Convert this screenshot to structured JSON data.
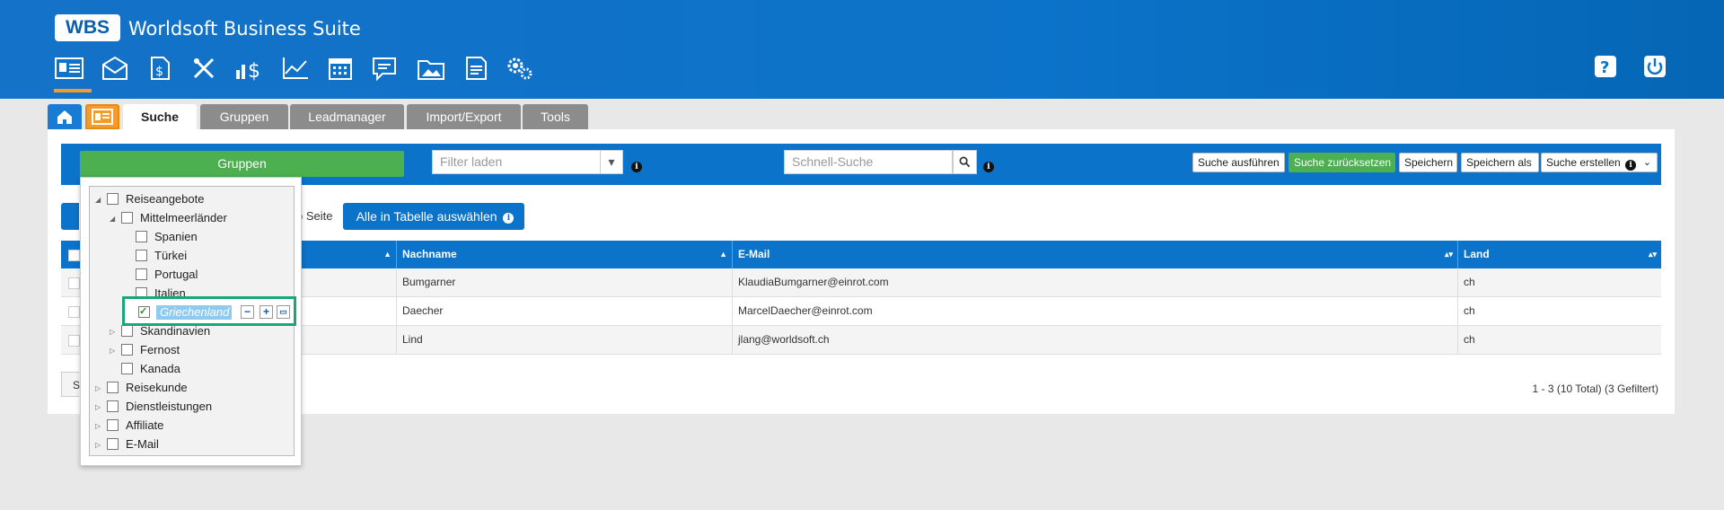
{
  "header": {
    "logo_text": "WBS",
    "app_title": "Worldsoft Business Suite",
    "module_icons": [
      "contacts-card-icon",
      "mail-icon",
      "document-dollar-icon",
      "tools-icon",
      "sales-dollar-icon",
      "chart-line-icon",
      "calendar-icon",
      "message-icon",
      "folder-images-icon",
      "newsletter-icon",
      "settings-gears-icon"
    ],
    "right_icons": [
      "help-icon",
      "power-icon"
    ]
  },
  "tabs": [
    {
      "label": "",
      "icon": "home-icon"
    },
    {
      "label": "",
      "icon": "contact-card-icon"
    },
    {
      "label": "Suche"
    },
    {
      "label": "Gruppen"
    },
    {
      "label": "Leadmanager"
    },
    {
      "label": "Import/Export"
    },
    {
      "label": "Tools"
    }
  ],
  "toolbar": {
    "groups_button": "Gruppen",
    "filter_placeholder": "Filter laden",
    "quick_search_placeholder": "Schnell-Suche",
    "buttons": [
      "Suche ausführen",
      "Suche zurücksetzen",
      "Speichern",
      "Speichern als",
      "Suche erstellen"
    ]
  },
  "actions": {
    "per_page_suffix": "o Seite",
    "select_all_button": "Alle in Tabelle auswählen"
  },
  "table": {
    "columns": [
      "Nachname",
      "E-Mail",
      "Land"
    ],
    "rows": [
      {
        "nachname": "Bumgarner",
        "email": "KlaudiaBumgarner@einrot.com",
        "land": "ch"
      },
      {
        "nachname": "Daecher",
        "email": "MarcelDaecher@einrot.com",
        "land": "ch"
      },
      {
        "nachname": "Lind",
        "email": "jlang@worldsoft.ch",
        "land": "ch"
      }
    ],
    "bottom_left_frag": "S",
    "pagination": "1 - 3 (10 Total) (3 Gefiltert)"
  },
  "tree": {
    "nodes": [
      {
        "label": "Reiseangebote",
        "level": 0,
        "expanded": true
      },
      {
        "label": "Mittelmeerländer",
        "level": 1,
        "expanded": true
      },
      {
        "label": "Spanien",
        "level": 2
      },
      {
        "label": "Türkei",
        "level": 2
      },
      {
        "label": "Portugal",
        "level": 2
      },
      {
        "label": "Italien",
        "level": 2
      },
      {
        "label": "Griechenland",
        "level": 2,
        "checked": true,
        "selected": true
      },
      {
        "label": "Skandinavien",
        "level": 1,
        "collapsed": true
      },
      {
        "label": "Fernost",
        "level": 1,
        "collapsed": true
      },
      {
        "label": "Kanada",
        "level": 1
      },
      {
        "label": "Reisekunde",
        "level": 0,
        "collapsed": true
      },
      {
        "label": "Dienstleistungen",
        "level": 0,
        "collapsed": true
      },
      {
        "label": "Affiliate",
        "level": 0,
        "collapsed": true
      },
      {
        "label": "E-Mail",
        "level": 0,
        "collapsed": true
      }
    ],
    "selected_actions": [
      "minus",
      "plus",
      "edit"
    ]
  },
  "colors": {
    "header_blue": "#0b73c9",
    "green": "#4caf50",
    "orange": "#f39c2c",
    "highlight_border": "#19a67a"
  }
}
